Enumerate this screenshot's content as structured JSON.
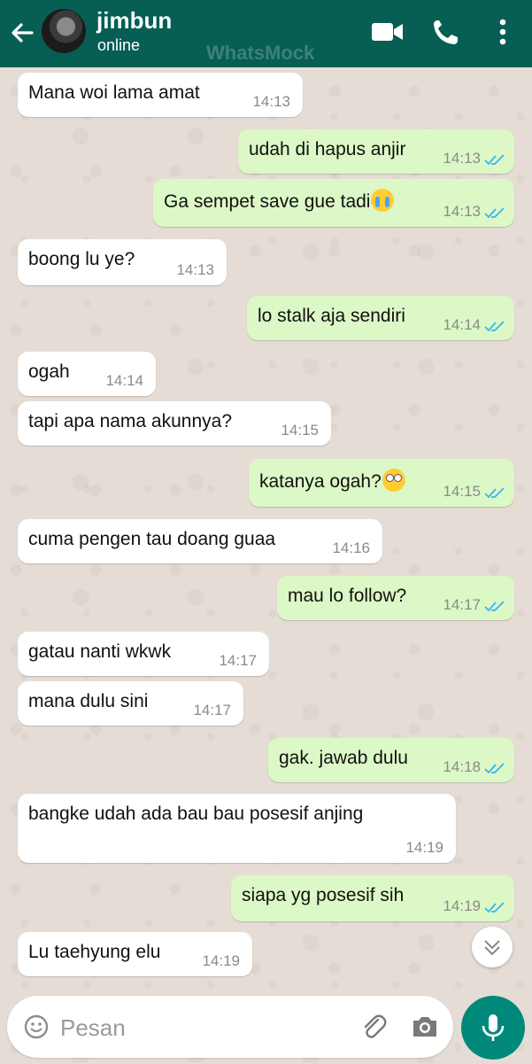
{
  "header": {
    "contact_name": "jimbun",
    "status": "online",
    "watermark": "WhatsMock"
  },
  "messages": [
    {
      "dir": "in",
      "text": "Mana woi lama amat",
      "time": "14:13"
    },
    {
      "dir": "out",
      "text": "udah di hapus anjir",
      "time": "14:13",
      "read": true
    },
    {
      "dir": "out",
      "text": "Ga sempet save gue tadi",
      "emoji": "crying-face-emoji",
      "time": "14:13",
      "read": true
    },
    {
      "dir": "in",
      "text": "boong lu ye?",
      "time": "14:13"
    },
    {
      "dir": "out",
      "text": "lo stalk aja sendiri",
      "time": "14:14",
      "read": true
    },
    {
      "dir": "in",
      "text": "ogah",
      "time": "14:14"
    },
    {
      "dir": "in",
      "text": "tapi apa nama akunnya?",
      "time": "14:15"
    },
    {
      "dir": "out",
      "text": "katanya ogah?",
      "emoji": "eye-roll-emoji",
      "time": "14:15",
      "read": true
    },
    {
      "dir": "in",
      "text": "cuma pengen tau doang guaa",
      "time": "14:16"
    },
    {
      "dir": "out",
      "text": "mau lo follow?",
      "time": "14:17",
      "read": true
    },
    {
      "dir": "in",
      "text": "gatau nanti wkwk",
      "time": "14:17"
    },
    {
      "dir": "in",
      "text": "mana dulu sini",
      "time": "14:17"
    },
    {
      "dir": "out",
      "text": "gak. jawab dulu",
      "time": "14:18",
      "read": true
    },
    {
      "dir": "in",
      "text": "bangke udah ada bau bau posesif anjing",
      "time": "14:19"
    },
    {
      "dir": "out",
      "text": "siapa yg posesif sih",
      "time": "14:19",
      "read": true
    },
    {
      "dir": "in",
      "text": "Lu taehyung elu",
      "time": "14:19"
    }
  ],
  "composer": {
    "placeholder": "Pesan",
    "value": ""
  },
  "colors": {
    "header": "#075e54",
    "outgoing_bubble": "#dcf8c6",
    "incoming_bubble": "#ffffff",
    "read_ticks": "#34b7f1",
    "mic_button": "#00897b",
    "wallpaper": "#e5ddd5"
  },
  "icons": {
    "back": "arrow-left-icon",
    "video": "video-camera-icon",
    "call": "phone-icon",
    "menu": "more-vertical-icon",
    "scroll": "double-chevron-down-icon",
    "emoji": "smiley-icon",
    "attach": "paperclip-icon",
    "camera": "camera-icon",
    "mic": "microphone-icon"
  }
}
